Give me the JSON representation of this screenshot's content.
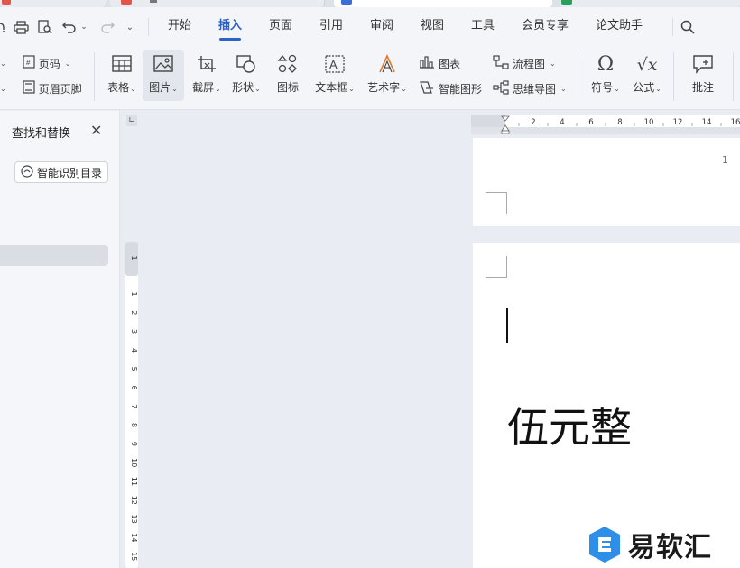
{
  "menu": {
    "tabs": [
      {
        "label": "开始",
        "active": false
      },
      {
        "label": "插入",
        "active": true
      },
      {
        "label": "页面",
        "active": false
      },
      {
        "label": "引用",
        "active": false
      },
      {
        "label": "审阅",
        "active": false
      },
      {
        "label": "视图",
        "active": false
      },
      {
        "label": "工具",
        "active": false
      },
      {
        "label": "会员专享",
        "active": false
      },
      {
        "label": "论文助手",
        "active": false
      }
    ]
  },
  "ribbon": {
    "page_number": "页码",
    "header_footer": "页眉页脚",
    "table": "表格",
    "picture": "图片",
    "screenshot": "截屏",
    "shape": "形状",
    "icon": "图标",
    "textbox": "文本框",
    "wordart": "艺术字",
    "chart": "图表",
    "smart_graphic": "智能图形",
    "flowchart": "流程图",
    "mindmap": "思维导图",
    "symbol": "符号",
    "formula": "公式",
    "comment": "批注"
  },
  "panel": {
    "title": "查找和替换",
    "smart_toc_button": "智能识别目录"
  },
  "ruler": {
    "horizontal_ticks": [
      "2",
      "4",
      "6",
      "8",
      "10",
      "12",
      "14",
      "16"
    ],
    "vertical_ticks": [
      "1",
      "1",
      "2",
      "3",
      "4",
      "5",
      "6",
      "7",
      "8",
      "9",
      "10",
      "11",
      "12",
      "13",
      "14",
      "15"
    ]
  },
  "document": {
    "page1_number": "1",
    "body_text": "伍元整"
  },
  "watermark": {
    "text": "易软汇"
  },
  "colors": {
    "accent": "#2b63c9",
    "background": "#e9ecf2",
    "ribbon": "#f3f5f8"
  }
}
